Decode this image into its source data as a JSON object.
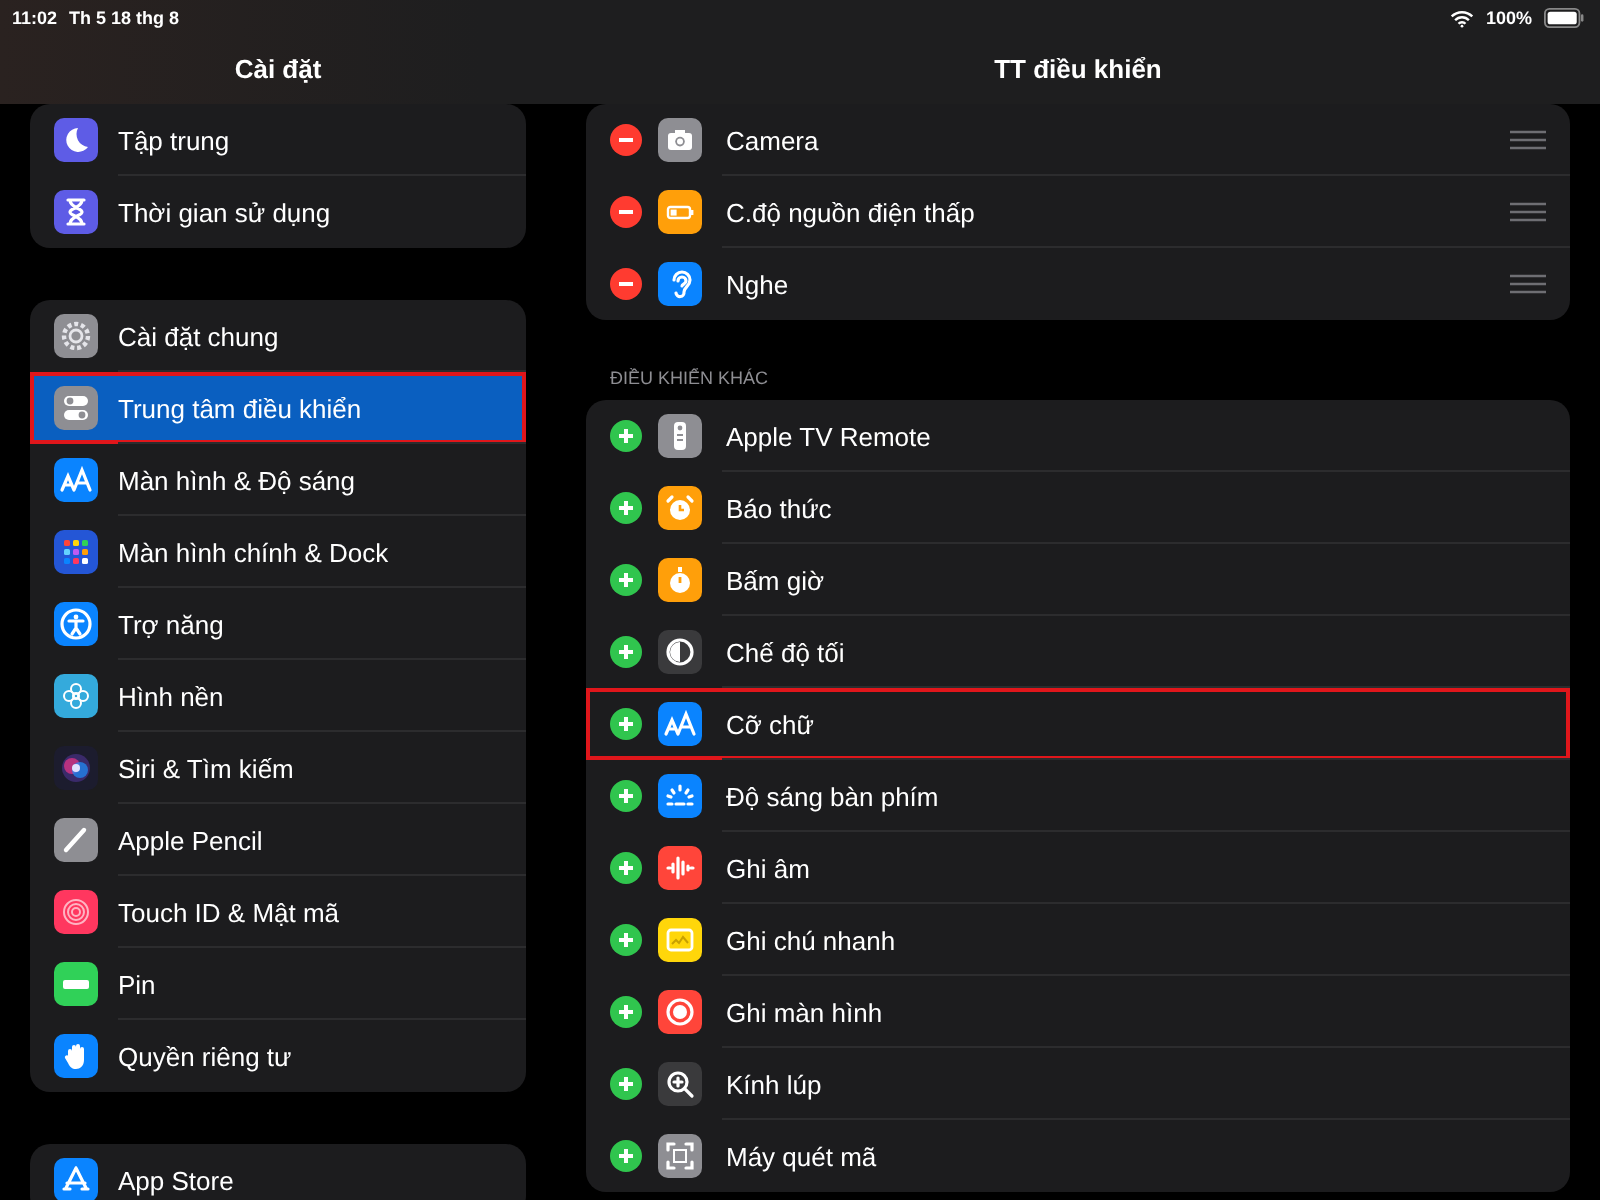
{
  "status_bar": {
    "time": "11:02",
    "date": "Th 5 18 thg 8",
    "battery": "100%"
  },
  "sidebar": {
    "title": "Cài đặt",
    "groups": [
      {
        "items": [
          {
            "label": "Tập trung",
            "selected": false,
            "annotated": false
          },
          {
            "label": "Thời gian sử dụng",
            "selected": false,
            "annotated": false
          }
        ]
      },
      {
        "items": [
          {
            "label": "Cài đặt chung",
            "selected": false,
            "annotated": false
          },
          {
            "label": "Trung tâm điều khiển",
            "selected": true,
            "annotated": true
          },
          {
            "label": "Màn hình & Độ sáng",
            "selected": false,
            "annotated": false
          },
          {
            "label": "Màn hình chính & Dock",
            "selected": false,
            "annotated": false
          },
          {
            "label": "Trợ năng",
            "selected": false,
            "annotated": false
          },
          {
            "label": "Hình nền",
            "selected": false,
            "annotated": false
          },
          {
            "label": "Siri & Tìm kiếm",
            "selected": false,
            "annotated": false
          },
          {
            "label": "Apple Pencil",
            "selected": false,
            "annotated": false
          },
          {
            "label": "Touch ID & Mật mã",
            "selected": false,
            "annotated": false
          },
          {
            "label": "Pin",
            "selected": false,
            "annotated": false
          },
          {
            "label": "Quyền riêng tư",
            "selected": false,
            "annotated": false
          }
        ]
      },
      {
        "items": [
          {
            "label": "App Store",
            "selected": false,
            "annotated": false
          }
        ]
      }
    ]
  },
  "detail": {
    "title": "TT điều khiển",
    "included": [
      {
        "label": "Camera",
        "annotated": false
      },
      {
        "label": "C.độ nguồn điện thấp",
        "annotated": false
      },
      {
        "label": "Nghe",
        "annotated": false
      }
    ],
    "more_header": "ĐIỀU KHIỂN KHÁC",
    "more": [
      {
        "label": "Apple TV Remote",
        "annotated": false
      },
      {
        "label": "Báo thức",
        "annotated": false
      },
      {
        "label": "Bấm giờ",
        "annotated": false
      },
      {
        "label": "Chế độ tối",
        "annotated": false
      },
      {
        "label": "Cỡ chữ",
        "annotated": true
      },
      {
        "label": "Độ sáng bàn phím",
        "annotated": false
      },
      {
        "label": "Ghi âm",
        "annotated": false
      },
      {
        "label": "Ghi chú nhanh",
        "annotated": false
      },
      {
        "label": "Ghi màn hình",
        "annotated": false
      },
      {
        "label": "Kính lúp",
        "annotated": false
      },
      {
        "label": "Máy quét mã",
        "annotated": false
      }
    ]
  }
}
